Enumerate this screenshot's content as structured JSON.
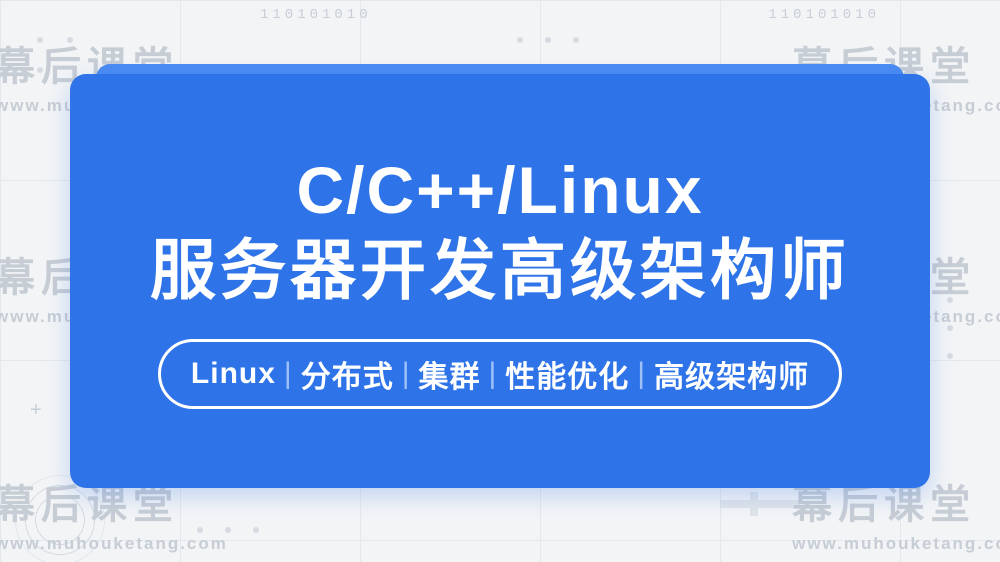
{
  "background": {
    "binary": "110101010",
    "watermark_text": "幕后课堂",
    "watermark_url": "www.muhouketang.com"
  },
  "card": {
    "accent_color": "#2e74e8",
    "title_line1": "C/C++/Linux",
    "title_line2": "服务器开发高级架构师",
    "tags": [
      "Linux",
      "分布式",
      "集群",
      "性能优化",
      "高级架构师"
    ]
  }
}
